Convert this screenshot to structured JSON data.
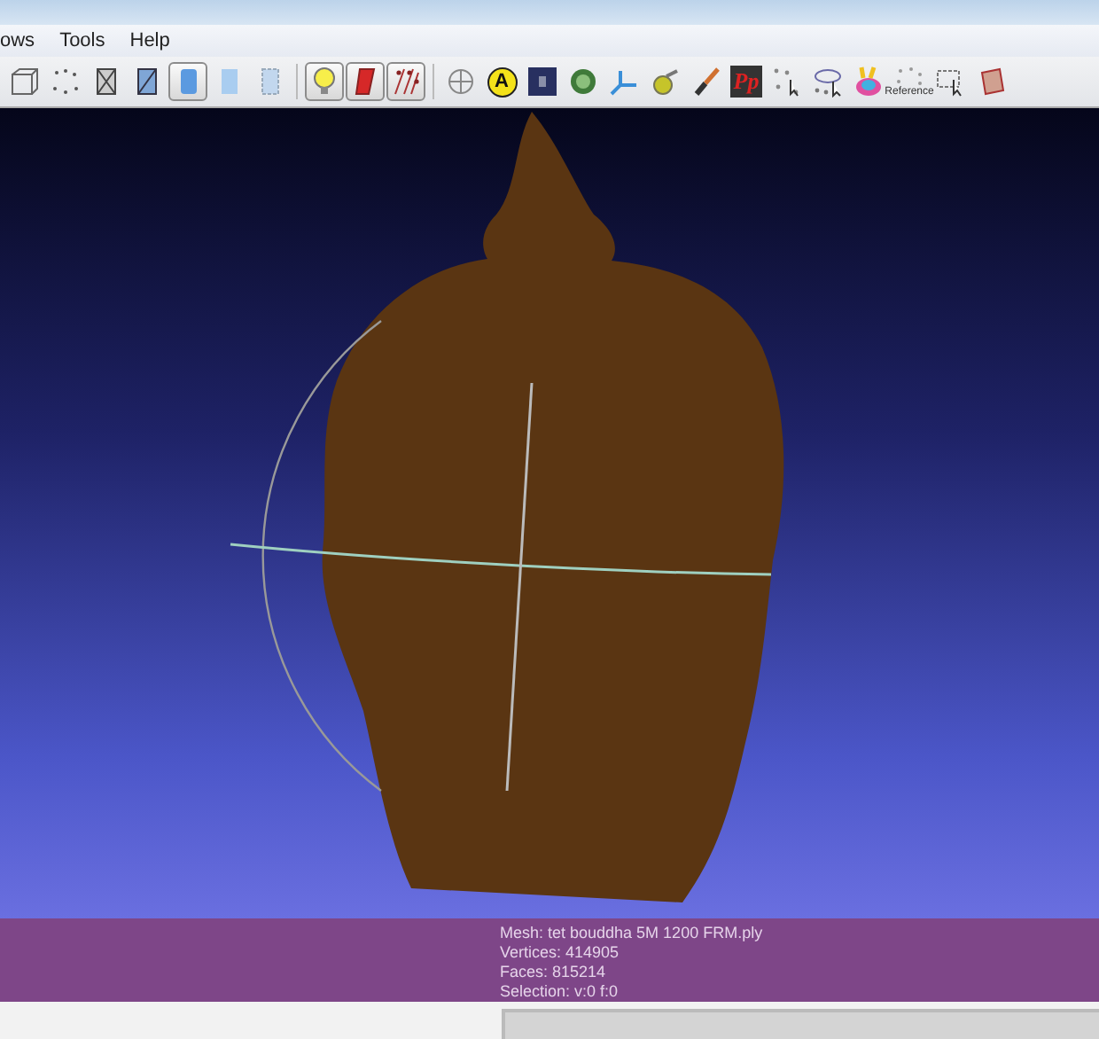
{
  "menu": [
    {
      "label": "ows"
    },
    {
      "label": "Tools"
    },
    {
      "label": "Help"
    }
  ],
  "toolbar": [
    {
      "kind": "box",
      "pressed": false
    },
    {
      "kind": "points",
      "pressed": false
    },
    {
      "kind": "wire",
      "pressed": false
    },
    {
      "kind": "flatlines",
      "pressed": false
    },
    {
      "kind": "smooth",
      "pressed": true
    },
    {
      "kind": "flat",
      "pressed": false
    },
    {
      "kind": "texture",
      "pressed": false
    },
    {
      "kind": "separator"
    },
    {
      "kind": "bulb",
      "pressed": true
    },
    {
      "kind": "redbar",
      "pressed": true
    },
    {
      "kind": "lines",
      "pressed": true
    },
    {
      "kind": "separator"
    },
    {
      "kind": "globe",
      "pressed": false
    },
    {
      "kind": "circle-a",
      "label": "A",
      "pressed": false
    },
    {
      "kind": "darksquare",
      "pressed": false
    },
    {
      "kind": "greenblob",
      "pressed": false
    },
    {
      "kind": "axes",
      "pressed": false
    },
    {
      "kind": "pear",
      "pressed": false
    },
    {
      "kind": "brush",
      "pressed": false
    },
    {
      "kind": "pp",
      "label": "Pp",
      "pressed": false
    },
    {
      "kind": "pointselect",
      "pressed": false
    },
    {
      "kind": "pointselect2",
      "pressed": false
    },
    {
      "kind": "bunny",
      "pressed": false
    },
    {
      "kind": "reference",
      "label": "Reference",
      "pressed": false
    },
    {
      "kind": "selectbox",
      "pressed": false
    },
    {
      "kind": "partial",
      "pressed": false
    }
  ],
  "mesh_info": [
    {
      "text": "Mesh: tet bouddha 5M 1200 FRM.ply"
    },
    {
      "text": "Vertices: 414905"
    },
    {
      "text": "Faces: 815214"
    },
    {
      "text": "Selection: v:0 f:0"
    }
  ]
}
